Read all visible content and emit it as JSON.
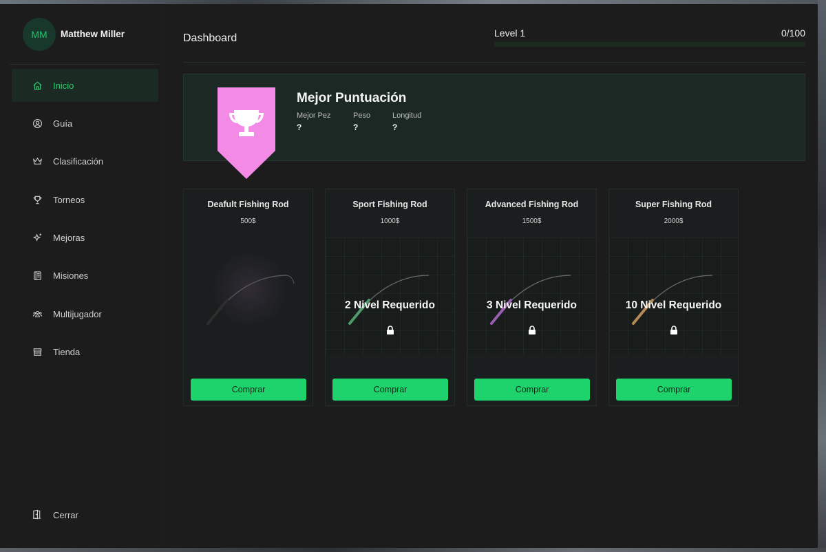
{
  "user": {
    "initials": "MM",
    "name": "Matthew Miller"
  },
  "sidebar": {
    "items": [
      {
        "label": "Inicio",
        "icon": "home-icon",
        "active": true
      },
      {
        "label": "Guía",
        "icon": "user-circle-icon",
        "active": false
      },
      {
        "label": "Clasificación",
        "icon": "crown-icon",
        "active": false
      },
      {
        "label": "Torneos",
        "icon": "trophy-icon",
        "active": false
      },
      {
        "label": "Mejoras",
        "icon": "sparkle-icon",
        "active": false
      },
      {
        "label": "Misiones",
        "icon": "book-icon",
        "active": false
      },
      {
        "label": "Multijugador",
        "icon": "users-icon",
        "active": false
      },
      {
        "label": "Tienda",
        "icon": "store-icon",
        "active": false
      }
    ],
    "logout_label": "Cerrar"
  },
  "header": {
    "title": "Dashboard",
    "level_label": "Level 1",
    "xp_text": "0/100",
    "xp_progress": 0
  },
  "best_score": {
    "title": "Mejor Puntuación",
    "stats": [
      {
        "label": "Mejor Pez",
        "value": "?"
      },
      {
        "label": "Peso",
        "value": "?"
      },
      {
        "label": "Longitud",
        "value": "?"
      }
    ]
  },
  "rods": [
    {
      "name": "Deafult Fishing Rod",
      "price": "500$",
      "locked": false,
      "requirement": "",
      "buy_label": "Comprar",
      "handle_color": "#3a3a3a"
    },
    {
      "name": "Sport Fishing Rod",
      "price": "1000$",
      "locked": true,
      "requirement": "2 Nivel Requerido",
      "buy_label": "Comprar",
      "handle_color": "#4f9a6a"
    },
    {
      "name": "Advanced Fishing Rod",
      "price": "1500$",
      "locked": true,
      "requirement": "3 Nivel Requerido",
      "buy_label": "Comprar",
      "handle_color": "#9a5fb0"
    },
    {
      "name": "Super Fishing Rod",
      "price": "2000$",
      "locked": true,
      "requirement": "10 Nivel Requerido",
      "buy_label": "Comprar",
      "handle_color": "#b58a55"
    }
  ],
  "colors": {
    "accent": "#22c46a",
    "button": "#1ed36b",
    "ribbon": "#f28ae6",
    "panel": "#1c1c1c"
  }
}
